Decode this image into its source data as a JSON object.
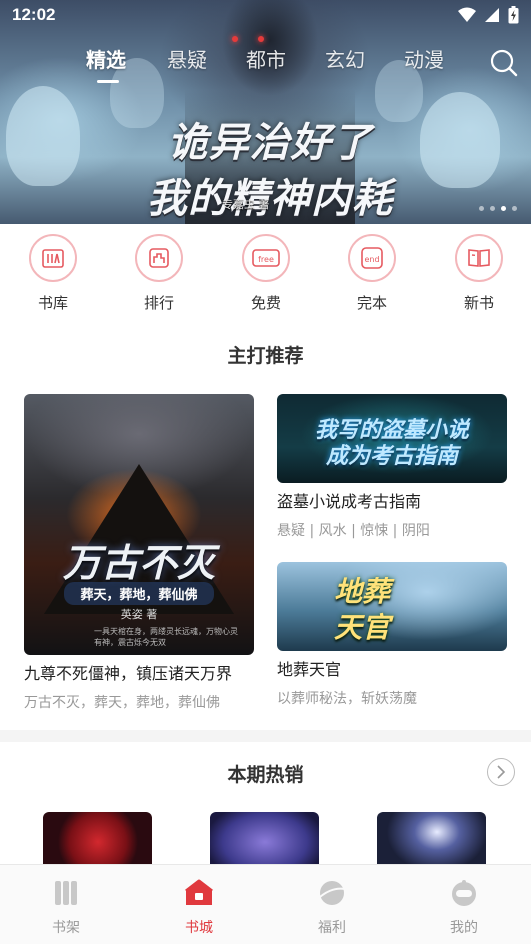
{
  "status_bar": {
    "time": "12:02"
  },
  "top_tabs": [
    {
      "label": "精选",
      "active": true
    },
    {
      "label": "悬疑",
      "active": false
    },
    {
      "label": "都市",
      "active": false
    },
    {
      "label": "玄幻",
      "active": false
    },
    {
      "label": "动漫",
      "active": false
    }
  ],
  "banner": {
    "title_line1": "诡异治好了",
    "title_line2": "我的精神内耗",
    "author": "专嘉虫 著",
    "dot_count": 4,
    "active_dot": 3
  },
  "categories": [
    {
      "label": "书库",
      "icon": "bookstore-icon"
    },
    {
      "label": "排行",
      "icon": "ranking-icon"
    },
    {
      "label": "免费",
      "icon": "free-icon",
      "icon_text": "free"
    },
    {
      "label": "完本",
      "icon": "finished-icon",
      "icon_text": "end"
    },
    {
      "label": "新书",
      "icon": "new-book-icon"
    }
  ],
  "featured": {
    "title": "主打推荐",
    "main_book": {
      "name": "九尊不死僵神，镇压诸天万界",
      "tags": "万古不灭，葬天，葬地，葬仙佛",
      "cover_title": "万古不灭",
      "cover_subtitle": "葬天，葬地，葬仙佛",
      "cover_author": "英姿 著",
      "cover_blurb": "一具天棺在身，两缕灵长远魂，万物心灵有神，震古烁今无双"
    },
    "side_books": [
      {
        "name": "盗墓小说成考古指南",
        "tags": "悬疑 | 风水 | 惊悚 | 阴阳",
        "cover_line1": "我写的盗墓小说",
        "cover_line2": "成为考古指南"
      },
      {
        "name": "地葬天官",
        "tags": "以葬师秘法，斩妖荡魔",
        "cover_line1": "地葬",
        "cover_line2": "天官"
      }
    ]
  },
  "hot_sales": {
    "title": "本期热销"
  },
  "bottom_nav": [
    {
      "label": "书架",
      "icon": "bookshelf-icon",
      "active": false
    },
    {
      "label": "书城",
      "icon": "bookstore-house-icon",
      "active": true
    },
    {
      "label": "福利",
      "icon": "welfare-planet-icon",
      "active": false
    },
    {
      "label": "我的",
      "icon": "profile-icon",
      "active": false
    }
  ],
  "colors": {
    "accent": "#e0393e",
    "category_ring": "#f3b6ba",
    "inactive_nav": "#999999"
  }
}
